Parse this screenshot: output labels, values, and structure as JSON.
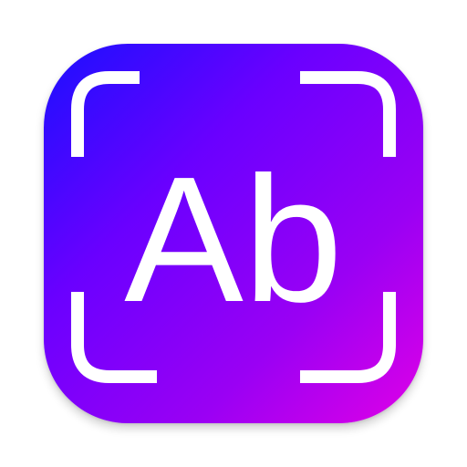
{
  "icon": {
    "name": "text-recognition-app-icon",
    "glyph_text": "Ab",
    "colors": {
      "gradient_start": "#1a10ff",
      "gradient_mid": "#7a00ff",
      "gradient_end": "#d800ee",
      "foreground": "#ffffff",
      "page_background": "#ffffff"
    }
  }
}
